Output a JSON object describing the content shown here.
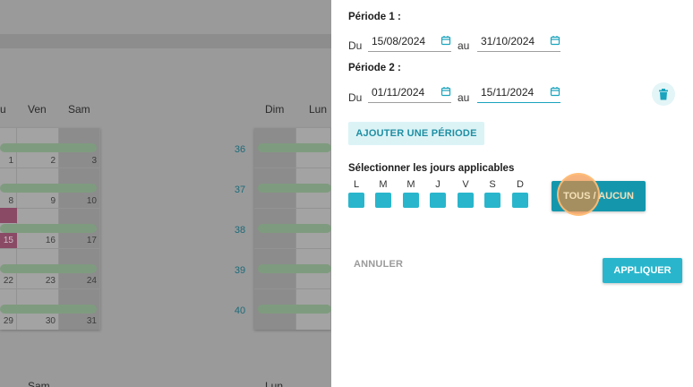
{
  "background_calendar": {
    "left_headers": [
      "u",
      "Ven",
      "Sam"
    ],
    "right_headers": [
      "Dim",
      "Lun"
    ],
    "left_days": [
      [
        "1",
        "2",
        "3"
      ],
      [
        "8",
        "9",
        "10"
      ],
      [
        "15",
        "16",
        "17"
      ],
      [
        "22",
        "23",
        "24"
      ],
      [
        "29",
        "30",
        "31"
      ]
    ],
    "week_numbers": [
      "36",
      "37",
      "38",
      "39",
      "40"
    ],
    "bottom_partial": [
      "Sam",
      "Lun"
    ]
  },
  "panel": {
    "period1": {
      "title": "Période 1 :",
      "from_label": "Du",
      "from_value": "15/08/2024",
      "to_label": "au",
      "to_value": "31/10/2024"
    },
    "period2": {
      "title": "Période 2 :",
      "from_label": "Du",
      "from_value": "01/11/2024",
      "to_label": "au",
      "to_value": "15/11/2024"
    },
    "add_period_label": "AJOUTER UNE PÉRIODE",
    "days_title": "Sélectionner les jours applicables",
    "days": [
      "L",
      "M",
      "M",
      "J",
      "V",
      "S",
      "D"
    ],
    "select_all_label": "TOUS / AUCUN",
    "cancel_label": "ANNULER",
    "apply_label": "APPLIQUER"
  },
  "colors": {
    "accent": "#29b6cc",
    "accent_dark": "#1497ad",
    "click_indicator": "#f38b38"
  },
  "icons": [
    "calendar-icon",
    "trash-icon"
  ]
}
